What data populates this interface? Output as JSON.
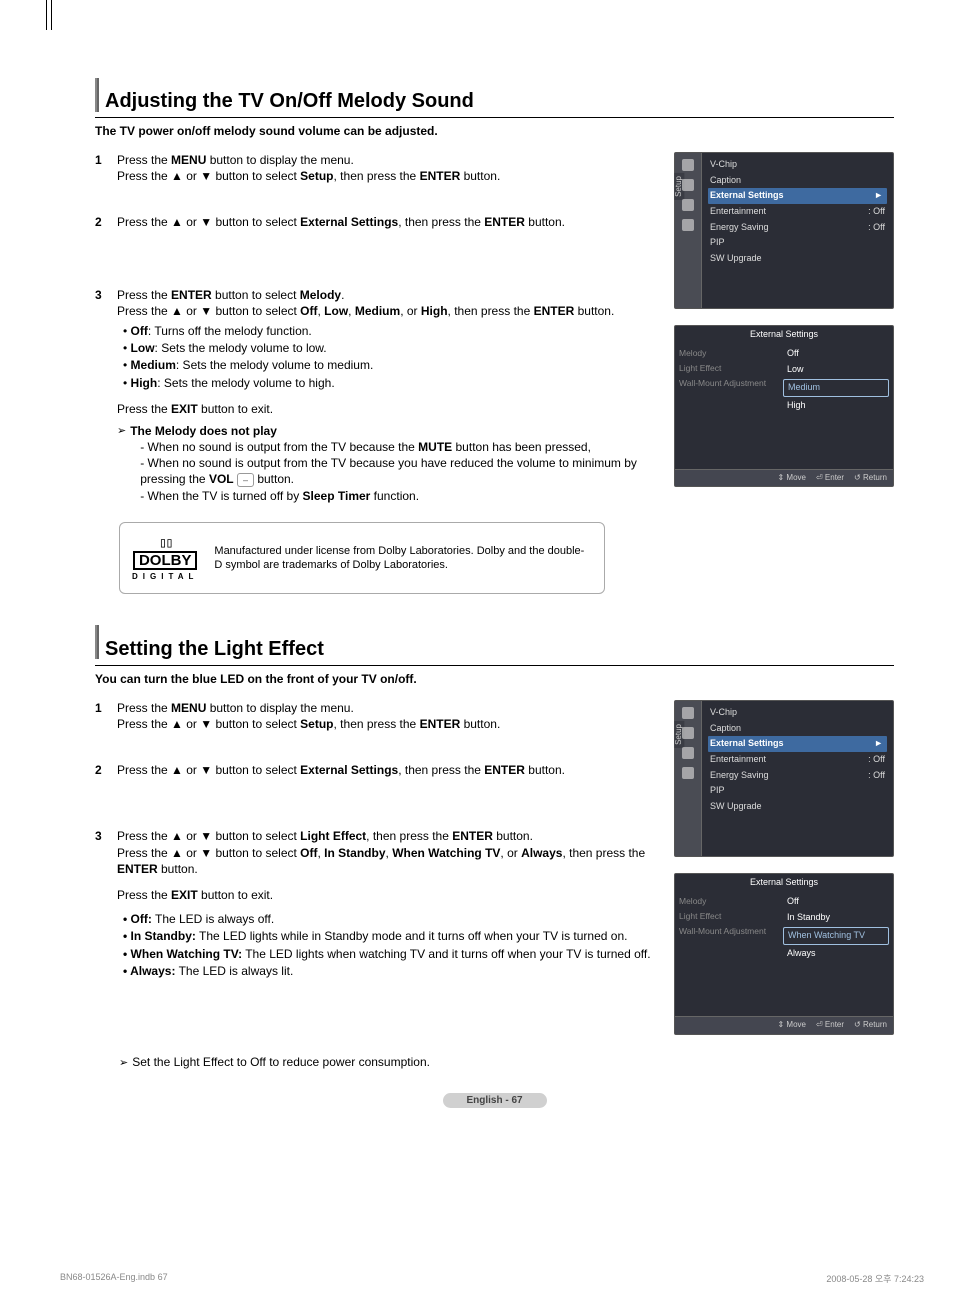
{
  "s1": {
    "title": "Adjusting the TV On/Off Melody Sound",
    "subtitle": "The TV power on/off melody sound volume can be adjusted.",
    "step1_a": "Press the ",
    "menu_b": "MENU",
    "step1_b": " button to display the menu.",
    "step1_c": "Press the ▲ or ▼ button to select ",
    "setup_b": "Setup",
    "step1_d": ", then press the ",
    "enter_b": "ENTER",
    "btn_txt": " button.",
    "step2_a": "Press the ▲ or ▼ button to select ",
    "ext_b": "External Settings",
    "step2_b": ", then press the ",
    "step3_a": "Press the ",
    "step3_b": " button to select ",
    "melody_b": "Melody",
    "period": ".",
    "step3_c": "Press the ▲ or ▼ button to select ",
    "off_b": "Off",
    "comma": ", ",
    "low_b": "Low",
    "med_b": "Medium",
    "or_txt": ", or ",
    "high_b": "High",
    "bullet_off": ": Turns off the melody function.",
    "bullet_low": ": Sets the melody volume to low.",
    "bullet_med": ": Sets the melody volume to medium.",
    "bullet_high": ": Sets the melody volume to high.",
    "exit_a": "Press the ",
    "exit_b": "EXIT",
    "exit_c": " button to exit.",
    "noplay_title": "The Melody does not play",
    "np1a": "- When no sound is output from the TV because the ",
    "mute_b": "MUTE",
    "np1b": " button has been pressed,",
    "np2a": "- When no sound is output from the TV because you have reduced the volume to minimum by pressing the ",
    "vol_b": "VOL",
    "np3a": "- When the TV is turned off by ",
    "sleep_b": "Sleep Timer",
    "np3b": " function.",
    "dolby_brand": "DOLBY",
    "dolby_sub": "DIGITAL",
    "dolby_txt": "Manufactured under license from Dolby Laboratories. Dolby and the double-D symbol are trademarks of Dolby Laboratories."
  },
  "s2": {
    "title": "Setting the Light Effect",
    "subtitle": "You can turn the blue LED on the front of your TV on/off.",
    "light_b": "Light Effect",
    "instdby_b": "In Standby",
    "wwtv_b": "When Watching TV",
    "always_b": "Always",
    "d_off": " The LED is always off.",
    "d_instdby": " The LED lights while in Standby mode and it turns off when your TV is turned on.",
    "d_wwtv": " The LED lights when watching TV and it turns off when your TV is turned off.",
    "d_always": " The LED is always lit.",
    "tip": "Set the Light Effect to Off to reduce power consumption."
  },
  "osd": {
    "setup_label": "Setup",
    "vchip": "V-Chip",
    "caption": "Caption",
    "external": "External Settings",
    "entertainment": "Entertainment",
    "energy": "Energy Saving",
    "pip": "PIP",
    "sw": "SW Upgrade",
    "off_val": ": Off",
    "arrow_r": "►",
    "ext_title": "External Settings",
    "melody": "Melody",
    "light": "Light Effect",
    "wall": "Wall-Mount Adjustment",
    "opt_off": "Off",
    "opt_low": "Low",
    "opt_med": "Medium",
    "opt_high": "High",
    "opt_instdby": "In Standby",
    "opt_wwtv": "When Watching TV",
    "opt_always": "Always",
    "f_move": "Move",
    "f_enter": "Enter",
    "f_return": "Return"
  },
  "footer": {
    "page_pill": "English - 67",
    "left": "BN68-01526A-Eng.indb   67",
    "right": "2008-05-28   오후 7:24:23"
  }
}
